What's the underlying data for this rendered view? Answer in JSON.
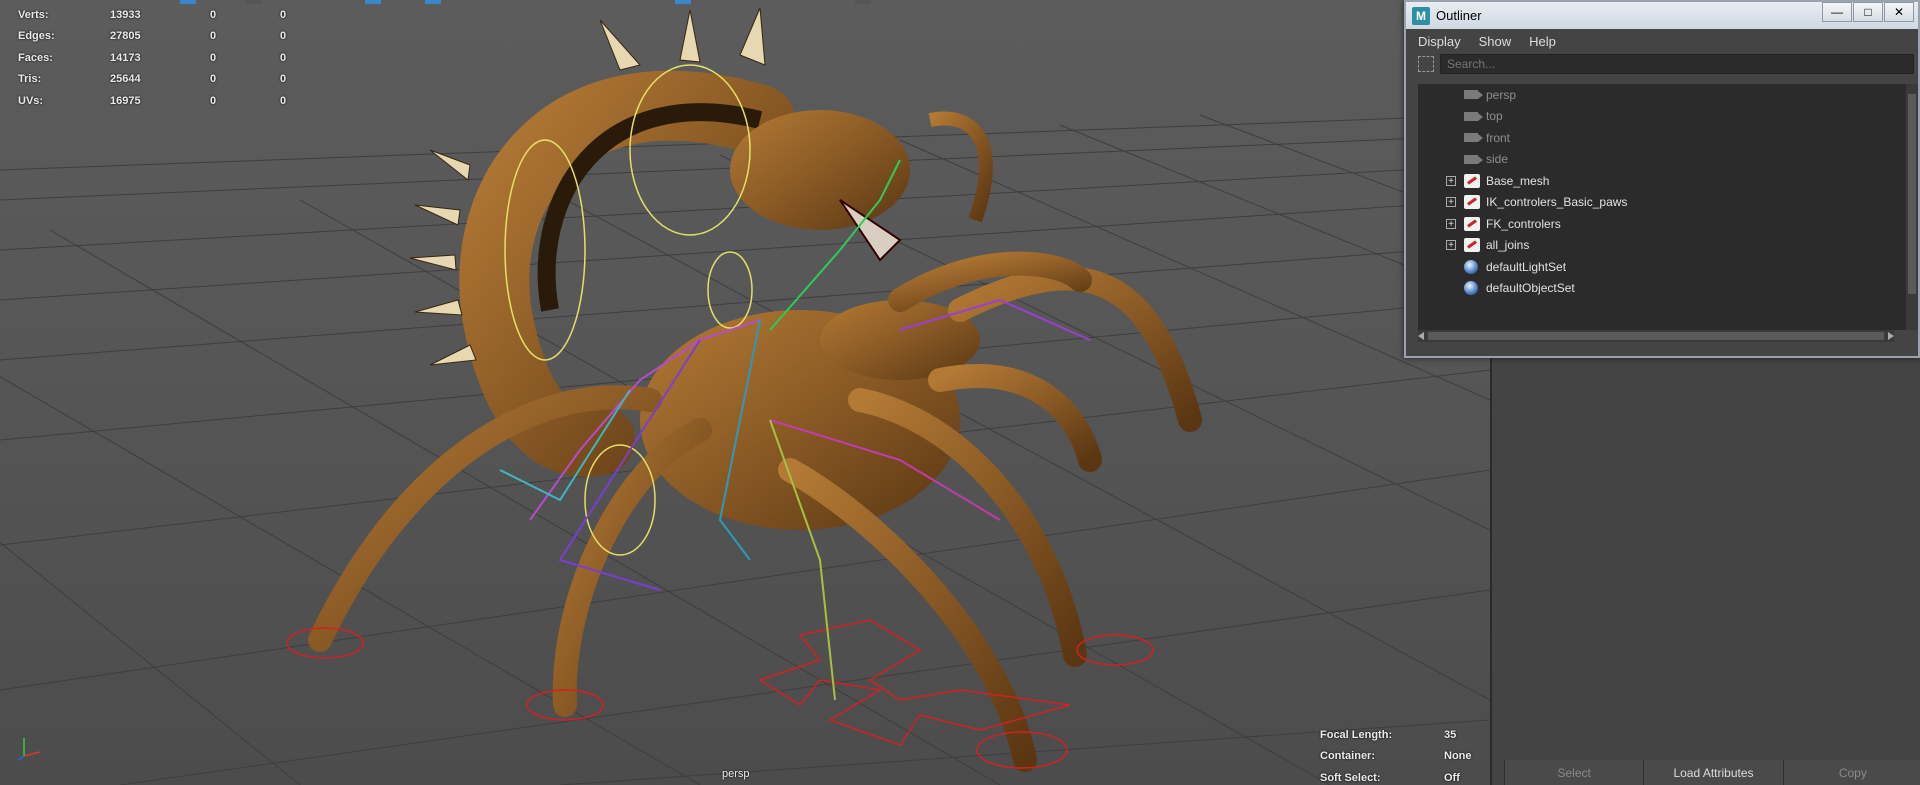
{
  "stats": [
    {
      "label": "Verts:",
      "v1": "13933",
      "v2": "0",
      "v3": "0"
    },
    {
      "label": "Edges:",
      "v1": "27805",
      "v2": "0",
      "v3": "0"
    },
    {
      "label": "Faces:",
      "v1": "14173",
      "v2": "0",
      "v3": "0"
    },
    {
      "label": "Tris:",
      "v1": "25644",
      "v2": "0",
      "v3": "0"
    },
    {
      "label": "UVs:",
      "v1": "16975",
      "v2": "0",
      "v3": "0"
    }
  ],
  "camera_info": [
    {
      "label": "Focal Length:",
      "value": "35"
    },
    {
      "label": "Container:",
      "value": "None"
    },
    {
      "label": "Soft Select:",
      "value": "Off"
    }
  ],
  "viewport": {
    "camera_label": "persp"
  },
  "outliner": {
    "title": "Outliner",
    "app_icon_letter": "M",
    "menu": [
      "Display",
      "Show",
      "Help"
    ],
    "search_placeholder": "Search...",
    "items": [
      {
        "label": "persp",
        "type": "camera",
        "dim": true
      },
      {
        "label": "top",
        "type": "camera",
        "dim": true
      },
      {
        "label": "front",
        "type": "camera",
        "dim": true
      },
      {
        "label": "side",
        "type": "camera",
        "dim": true
      },
      {
        "label": "Base_mesh",
        "type": "group",
        "dim": false
      },
      {
        "label": "IK_controlers_Basic_paws",
        "type": "group",
        "dim": false
      },
      {
        "label": "FK_controlers",
        "type": "group",
        "dim": false
      },
      {
        "label": "all_joins",
        "type": "group",
        "dim": false
      },
      {
        "label": "defaultLightSet",
        "type": "set",
        "dim": false
      },
      {
        "label": "defaultObjectSet",
        "type": "set",
        "dim": false
      }
    ]
  },
  "attribute_editor": {
    "buttons": [
      "Select",
      "Load Attributes",
      "Copy"
    ]
  }
}
